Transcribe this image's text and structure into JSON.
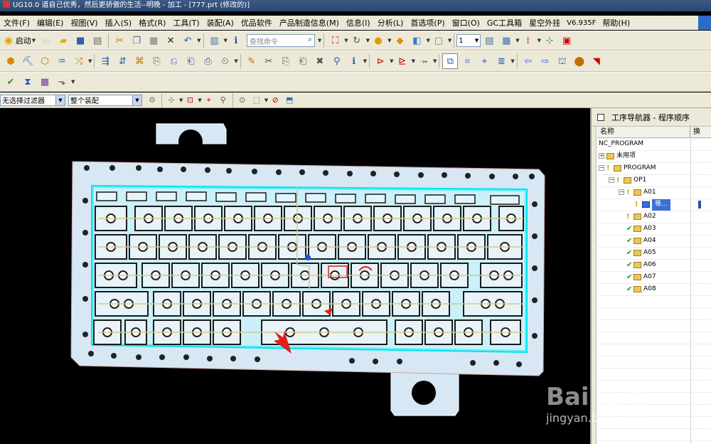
{
  "window": {
    "title": "UG10.0 道自己优秀，然后更骄傲的生活--明晚 - 加工 - [777.prt (修改的)]"
  },
  "menu": {
    "items": [
      "文件(F)",
      "编辑(E)",
      "视图(V)",
      "插入(S)",
      "格式(R)",
      "工具(T)",
      "装配(A)",
      "优品软件",
      "产品制造信息(M)",
      "信息(I)",
      "分析(L)",
      "首选项(P)",
      "窗口(O)",
      "GC工具箱",
      "星空外挂"
    ],
    "version": "V6.935F",
    "help": "帮助(H)"
  },
  "toolbar": {
    "start_label": "启动",
    "command_search_placeholder": "查找命令",
    "layer_value": "1"
  },
  "selection_bar": {
    "type_filter": "无选择过滤器",
    "scope": "整个装配"
  },
  "navigator": {
    "title": "工序导航器 - 程序顺序",
    "col_name": "名称",
    "col_swap": "换",
    "nodes": [
      {
        "label": "NC_PROGRAM",
        "status": "",
        "level": 0
      },
      {
        "label": "未用项",
        "status": "",
        "level": 0
      },
      {
        "label": "PROGRAM",
        "status": "warn",
        "level": 0
      },
      {
        "label": "OP1",
        "status": "warn",
        "level": 1
      },
      {
        "label": "A01",
        "status": "warn",
        "level": 2
      },
      {
        "label": "等...",
        "status": "warn",
        "level": 3
      },
      {
        "label": "A02",
        "status": "warn",
        "level": 2
      },
      {
        "label": "A03",
        "status": "ok",
        "level": 2
      },
      {
        "label": "A04",
        "status": "ok",
        "level": 2
      },
      {
        "label": "A05",
        "status": "ok",
        "level": 2
      },
      {
        "label": "A06",
        "status": "ok",
        "level": 2
      },
      {
        "label": "A07",
        "status": "ok",
        "level": 2
      },
      {
        "label": "A08",
        "status": "ok",
        "level": 2
      }
    ]
  },
  "colors": {
    "part_fill": "#d7e8f4",
    "toolpath": "#00e5ee",
    "toolpath_link": "#d2c98b",
    "annotation_arrow": "#e0201a"
  },
  "watermark": {
    "logo": "Bai 经验",
    "url": "jingyan.baidu.com"
  }
}
